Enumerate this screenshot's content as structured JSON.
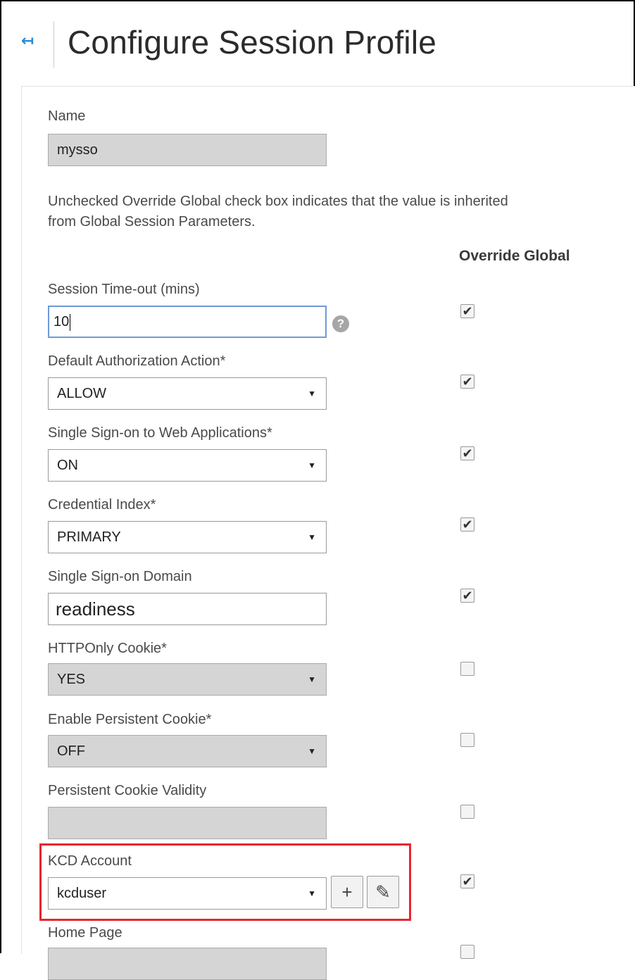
{
  "header": {
    "title": "Configure Session Profile",
    "back_icon": "back-arrow-icon"
  },
  "name_field": {
    "label": "Name",
    "value": "mysso"
  },
  "note": "Unchecked Override Global check box indicates that the value is inherited from Global Session Parameters.",
  "override_header": "Override Global",
  "fields": [
    {
      "label": "Session Time-out (mins)",
      "value": "10",
      "override": true
    },
    {
      "label": "Default Authorization Action*",
      "value": "ALLOW",
      "override": true
    },
    {
      "label": "Single Sign-on to Web Applications*",
      "value": "ON",
      "override": true
    },
    {
      "label": "Credential Index*",
      "value": "PRIMARY",
      "override": true
    },
    {
      "label": "Single Sign-on Domain",
      "value": "readiness",
      "override": true
    },
    {
      "label": "HTTPOnly Cookie*",
      "value": "YES",
      "override": false
    },
    {
      "label": "Enable Persistent Cookie*",
      "value": "OFF",
      "override": false
    },
    {
      "label": "Persistent Cookie Validity",
      "value": "",
      "override": false
    },
    {
      "label": "KCD Account",
      "value": "kcduser",
      "override": true
    },
    {
      "label": "Home Page",
      "value": "",
      "override": false
    }
  ],
  "glyphs": {
    "dropdown": "▼",
    "check": "✔",
    "add": "+",
    "edit": "✎",
    "help": "?",
    "back": "↤"
  },
  "colors": {
    "accent": "#2a8ad4",
    "highlight": "#e8262f",
    "disabled_bg": "#d5d5d5",
    "focus_border": "#6e9ad6"
  }
}
